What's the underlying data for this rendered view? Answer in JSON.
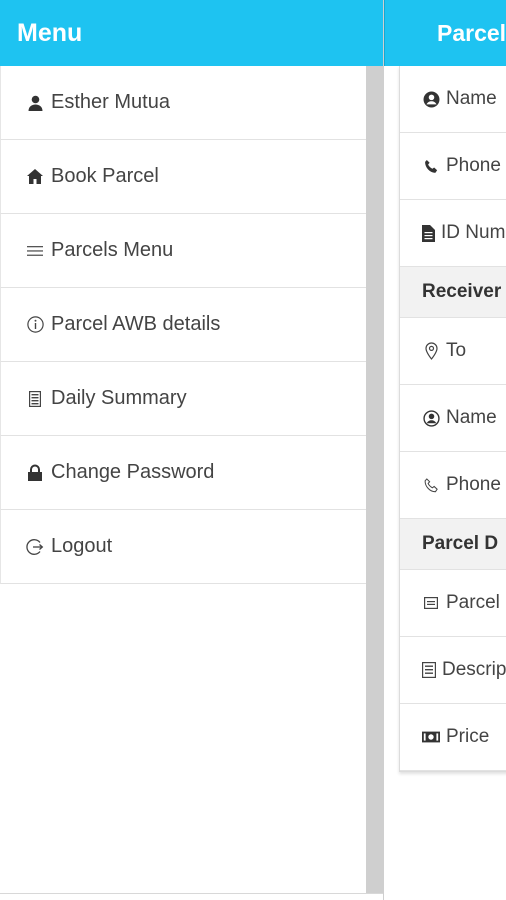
{
  "header": {
    "menu_title": "Menu",
    "page_title": "Parcel"
  },
  "sidebar": {
    "items": [
      {
        "label": "Esther Mutua",
        "icon": "user-icon"
      },
      {
        "label": "Book Parcel",
        "icon": "home-icon"
      },
      {
        "label": "Parcels Menu",
        "icon": "menu-lines-icon"
      },
      {
        "label": "Parcel AWB details",
        "icon": "info-circle-icon"
      },
      {
        "label": "Daily Summary",
        "icon": "document-icon"
      },
      {
        "label": "Change Password",
        "icon": "lock-icon"
      },
      {
        "label": "Logout",
        "icon": "logout-icon"
      }
    ]
  },
  "form": {
    "sender_name": "Name",
    "sender_phone": "Phone",
    "sender_id": "ID Number",
    "receiver_section": "Receiver",
    "receiver_to": "To",
    "receiver_name": "Name",
    "receiver_phone": "Phone",
    "parcel_section": "Parcel D",
    "parcel_type": "Parcel",
    "parcel_description": "Description",
    "parcel_price": "Price"
  },
  "colors": {
    "accent": "#1ec3f1"
  }
}
